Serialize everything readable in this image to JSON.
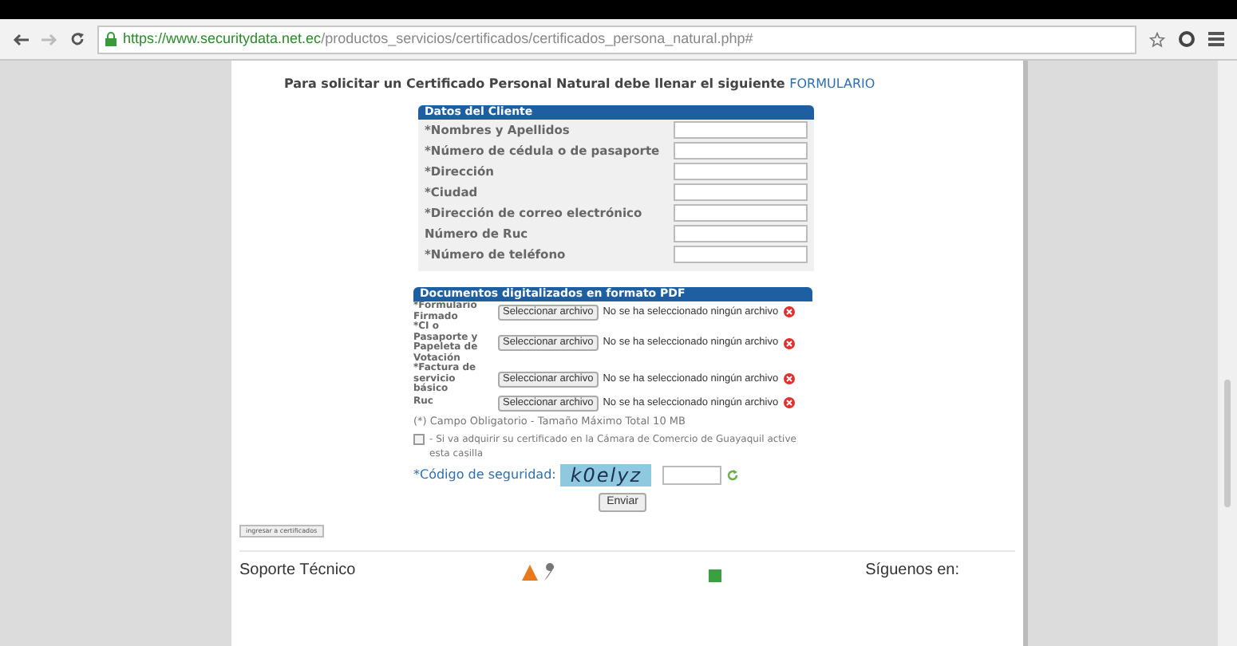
{
  "browser": {
    "url_host": "https://www.securitydata.net.ec",
    "url_path": "/productos_servicios/certificados/certificados_persona_natural.php#"
  },
  "intro": {
    "text": "Para solicitar un Certificado Personal Natural debe llenar el siguiente",
    "link": "FORMULARIO"
  },
  "client_table": {
    "title": "Datos del Cliente",
    "fields": [
      {
        "label": "*Nombres y Apellidos"
      },
      {
        "label": "*Número de cédula o de pasaporte"
      },
      {
        "label": "*Dirección"
      },
      {
        "label": "*Ciudad"
      },
      {
        "label": "*Dirección de correo electrónico"
      },
      {
        "label": "Número de Ruc"
      },
      {
        "label": "*Número de teléfono"
      }
    ]
  },
  "documents_table": {
    "title": "Documentos digitalizados en formato PDF",
    "rows": [
      {
        "label": "*Formulario Firmado",
        "button": "Seleccionar archivo",
        "status": "No se ha seleccionado ningún archivo"
      },
      {
        "label": "*CI o Pasaporte y Papeleta de Votación",
        "button": "Seleccionar archivo",
        "status": "No se ha seleccionado ningún archivo"
      },
      {
        "label": "*Factura de servicio básico",
        "button": "Seleccionar archivo",
        "status": "No se ha seleccionado ningún archivo"
      },
      {
        "label": "Ruc",
        "button": "Seleccionar archivo",
        "status": "No se ha seleccionado ningún archivo"
      }
    ]
  },
  "note": "(*) Campo Obligatorio - Tamaño Máximo Total 10 MB",
  "chamber_checkbox": {
    "label": "- Si va adquirir su certificado en la Cámara de Comercio de Guayaquil active esta casilla",
    "checked": false
  },
  "captcha": {
    "label": "*Código de seguridad:",
    "code": "k0elyz"
  },
  "submit": "Enviar",
  "small_button": "ingresar a certificados",
  "footer": {
    "support": "Soporte Técnico",
    "follow": "Síguenos en:"
  }
}
